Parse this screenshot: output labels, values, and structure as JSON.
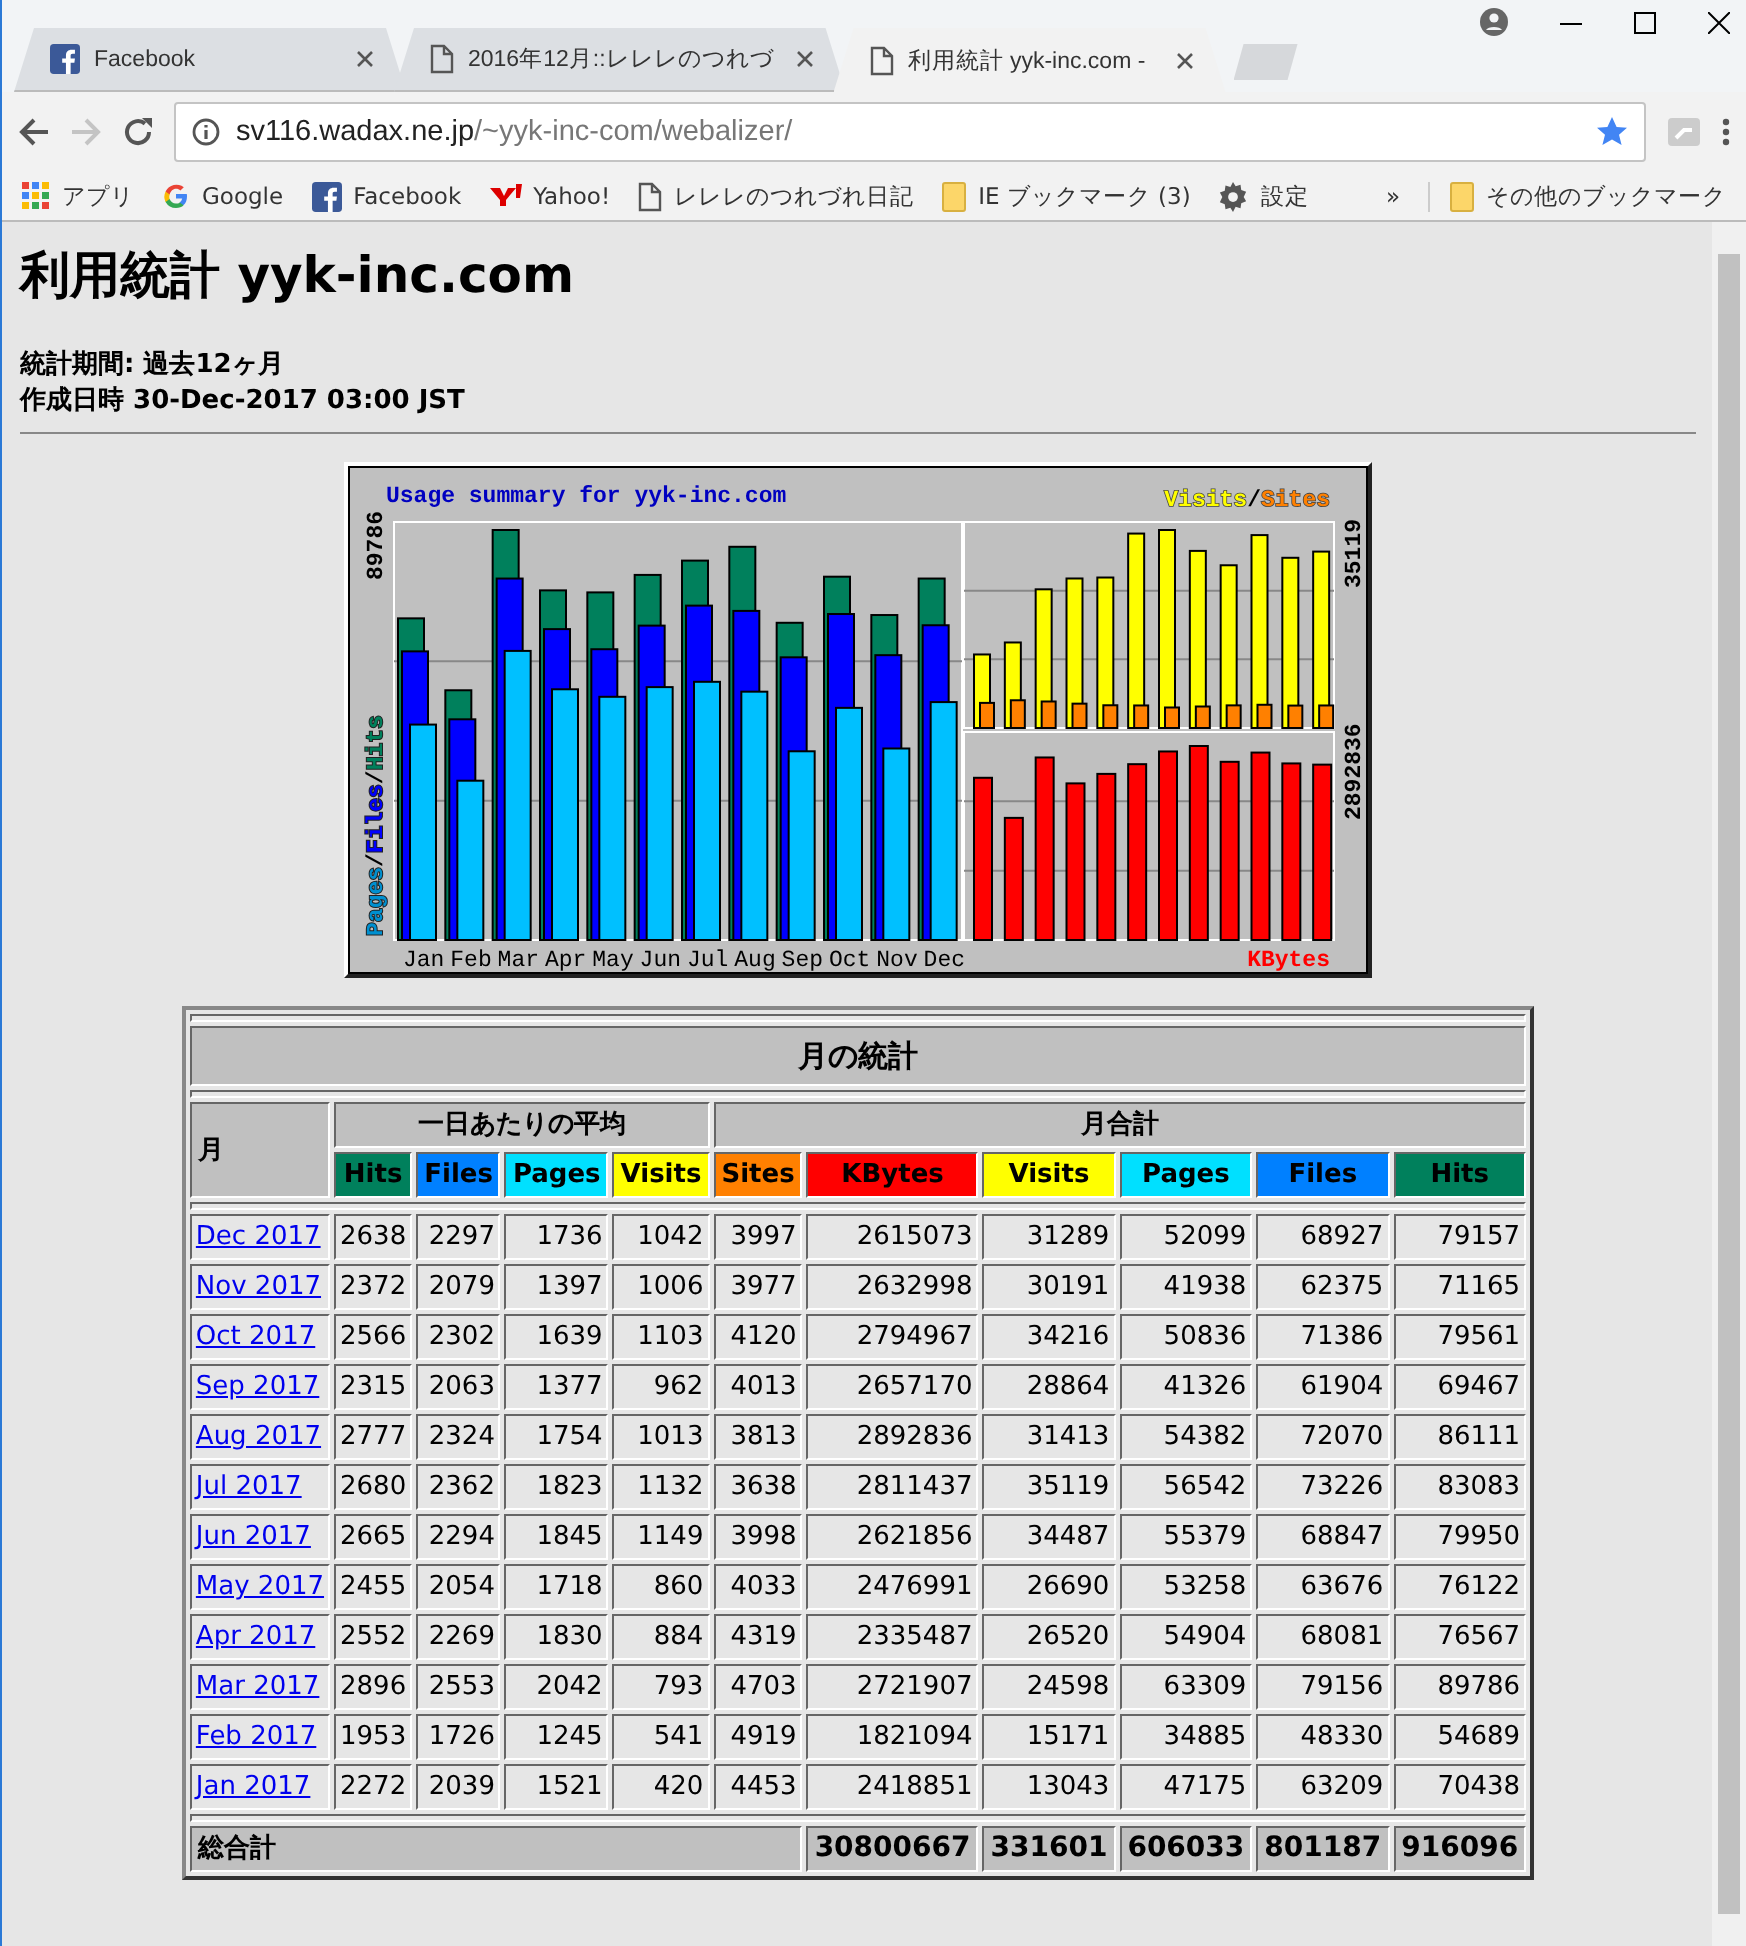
{
  "browser": {
    "tabs": [
      {
        "title": "Facebook",
        "kind": "facebook",
        "selected": false
      },
      {
        "title": "2016年12月::レレレのつれづ",
        "kind": "page",
        "selected": false
      },
      {
        "title": "利用統計 yyk-inc.com -",
        "kind": "page",
        "selected": true
      }
    ],
    "forward_disabled": true,
    "address": {
      "host": "sv116.wadax.ne.jp",
      "path": "/~yyk-inc-com/webalizer/"
    },
    "bookmarks": [
      {
        "label": "アプリ",
        "kind": "apps"
      },
      {
        "label": "Google",
        "kind": "google"
      },
      {
        "label": "Facebook",
        "kind": "facebook"
      },
      {
        "label": "Yahoo!",
        "kind": "yahoo"
      },
      {
        "label": "レレレのつれづれ日記",
        "kind": "page"
      },
      {
        "label": "IE ブックマーク (3)",
        "kind": "folder"
      },
      {
        "label": "設定",
        "kind": "gear"
      }
    ],
    "overflow": "»",
    "other_bookmarks": "その他のブックマーク"
  },
  "page": {
    "title": "利用統計 yyk-inc.com",
    "period": "統計期間: 過去12ヶ月",
    "generated": "作成日時 30-Dec-2017 03:00 JST"
  },
  "chart": {
    "title": "Usage summary for yyk-inc.com",
    "months": [
      "Jan",
      "Feb",
      "Mar",
      "Apr",
      "May",
      "Jun",
      "Jul",
      "Aug",
      "Sep",
      "Oct",
      "Nov",
      "Dec"
    ],
    "left_max": "89786",
    "right_top_max": "35119",
    "right_bottom_max": "2892836",
    "separator": "/",
    "left_legend": [
      {
        "label": "Pages",
        "color": "#0090d0"
      },
      {
        "label": "Files",
        "color": "#0000ff"
      },
      {
        "label": "Hits",
        "color": "#00805c"
      }
    ],
    "right_legend": [
      {
        "label": "Visits",
        "color": "#ffff00"
      },
      {
        "label": "Sites",
        "color": "#ff8000"
      }
    ],
    "bottom_label": "KBytes"
  },
  "table": {
    "title": "月の統計",
    "month_header": "月",
    "daily_header": "一日あたりの平均",
    "total_header": "月合計",
    "columns": [
      {
        "label": "Hits",
        "color": "#00805c"
      },
      {
        "label": "Files",
        "color": "#0080ff"
      },
      {
        "label": "Pages",
        "color": "#00e0ff"
      },
      {
        "label": "Visits",
        "color": "#ffff00"
      },
      {
        "label": "Sites",
        "color": "#ff8000"
      },
      {
        "label": "KBytes",
        "color": "#ff0000"
      },
      {
        "label": "Visits",
        "color": "#ffff00"
      },
      {
        "label": "Pages",
        "color": "#00e0ff"
      },
      {
        "label": "Files",
        "color": "#0080ff"
      },
      {
        "label": "Hits",
        "color": "#00805c"
      }
    ],
    "rows": [
      {
        "month": "Dec 2017",
        "values": [
          "2638",
          "2297",
          "1736",
          "1042",
          "3997",
          "2615073",
          "31289",
          "52099",
          "68927",
          "79157"
        ]
      },
      {
        "month": "Nov 2017",
        "values": [
          "2372",
          "2079",
          "1397",
          "1006",
          "3977",
          "2632998",
          "30191",
          "41938",
          "62375",
          "71165"
        ]
      },
      {
        "month": "Oct 2017",
        "values": [
          "2566",
          "2302",
          "1639",
          "1103",
          "4120",
          "2794967",
          "34216",
          "50836",
          "71386",
          "79561"
        ]
      },
      {
        "month": "Sep 2017",
        "values": [
          "2315",
          "2063",
          "1377",
          "962",
          "4013",
          "2657170",
          "28864",
          "41326",
          "61904",
          "69467"
        ]
      },
      {
        "month": "Aug 2017",
        "values": [
          "2777",
          "2324",
          "1754",
          "1013",
          "3813",
          "2892836",
          "31413",
          "54382",
          "72070",
          "86111"
        ]
      },
      {
        "month": "Jul 2017",
        "values": [
          "2680",
          "2362",
          "1823",
          "1132",
          "3638",
          "2811437",
          "35119",
          "56542",
          "73226",
          "83083"
        ]
      },
      {
        "month": "Jun 2017",
        "values": [
          "2665",
          "2294",
          "1845",
          "1149",
          "3998",
          "2621856",
          "34487",
          "55379",
          "68847",
          "79950"
        ]
      },
      {
        "month": "May 2017",
        "values": [
          "2455",
          "2054",
          "1718",
          "860",
          "4033",
          "2476991",
          "26690",
          "53258",
          "63676",
          "76122"
        ]
      },
      {
        "month": "Apr 2017",
        "values": [
          "2552",
          "2269",
          "1830",
          "884",
          "4319",
          "2335487",
          "26520",
          "54904",
          "68081",
          "76567"
        ]
      },
      {
        "month": "Mar 2017",
        "values": [
          "2896",
          "2553",
          "2042",
          "793",
          "4703",
          "2721907",
          "24598",
          "63309",
          "79156",
          "89786"
        ]
      },
      {
        "month": "Feb 2017",
        "values": [
          "1953",
          "1726",
          "1245",
          "541",
          "4919",
          "1821094",
          "15171",
          "34885",
          "48330",
          "54689"
        ]
      },
      {
        "month": "Jan 2017",
        "values": [
          "2272",
          "2039",
          "1521",
          "420",
          "4453",
          "2418851",
          "13043",
          "47175",
          "63209",
          "70438"
        ]
      }
    ],
    "totals_label": "総合計",
    "totals": [
      "30800667",
      "331601",
      "606033",
      "801187",
      "916096"
    ]
  }
}
